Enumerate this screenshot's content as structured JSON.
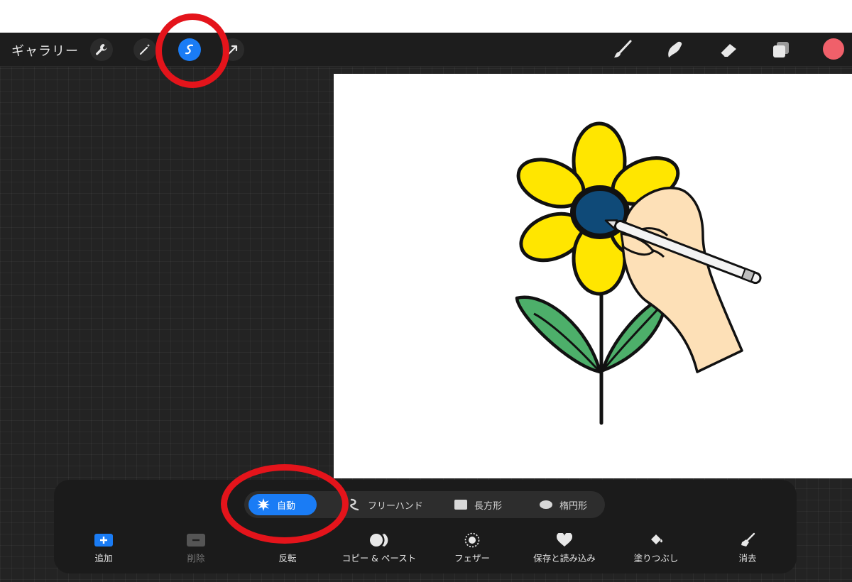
{
  "toolbar": {
    "gallery_label": "ギャラリー",
    "left_tools": [
      "wrench-icon",
      "magic-wand-icon",
      "selection-icon",
      "transform-arrow-icon"
    ],
    "right_tools": [
      "brush-icon",
      "smudge-icon",
      "eraser-icon",
      "layers-icon"
    ],
    "active_tool": "selection-icon",
    "current_color": "#f0606a"
  },
  "selection_panel": {
    "modes": [
      {
        "label": "自動",
        "icon": "auto-starburst-icon",
        "active": true
      },
      {
        "label": "フリーハンド",
        "icon": "freehand-icon",
        "active": false
      },
      {
        "label": "長方形",
        "icon": "rectangle-icon",
        "active": false
      },
      {
        "label": "楕円形",
        "icon": "ellipse-icon",
        "active": false
      }
    ],
    "actions": [
      {
        "label": "追加",
        "icon": "plus-icon",
        "enabled": true
      },
      {
        "label": "削除",
        "icon": "minus-icon",
        "enabled": false
      },
      {
        "label": "反転",
        "icon": "invert-icon",
        "enabled": true
      },
      {
        "label": "コピー & ペースト",
        "icon": "copy-paste-icon",
        "enabled": true
      },
      {
        "label": "フェザー",
        "icon": "feather-icon",
        "enabled": true
      },
      {
        "label": "保存と読み込み",
        "icon": "heart-icon",
        "enabled": true
      },
      {
        "label": "塗りつぶし",
        "icon": "fill-bucket-icon",
        "enabled": true
      },
      {
        "label": "消去",
        "icon": "broom-icon",
        "enabled": true
      }
    ]
  },
  "canvas": {
    "content": "flower-with-hand-drawing-illustration",
    "colors": {
      "petals": "#ffe600",
      "center": "#0f4a78",
      "leaves": "#4daf6a",
      "skin": "#fde0b7"
    }
  },
  "annotations": {
    "highlight_color": "#e4141b",
    "highlighted": [
      "selection-icon",
      "mode-auto"
    ]
  }
}
